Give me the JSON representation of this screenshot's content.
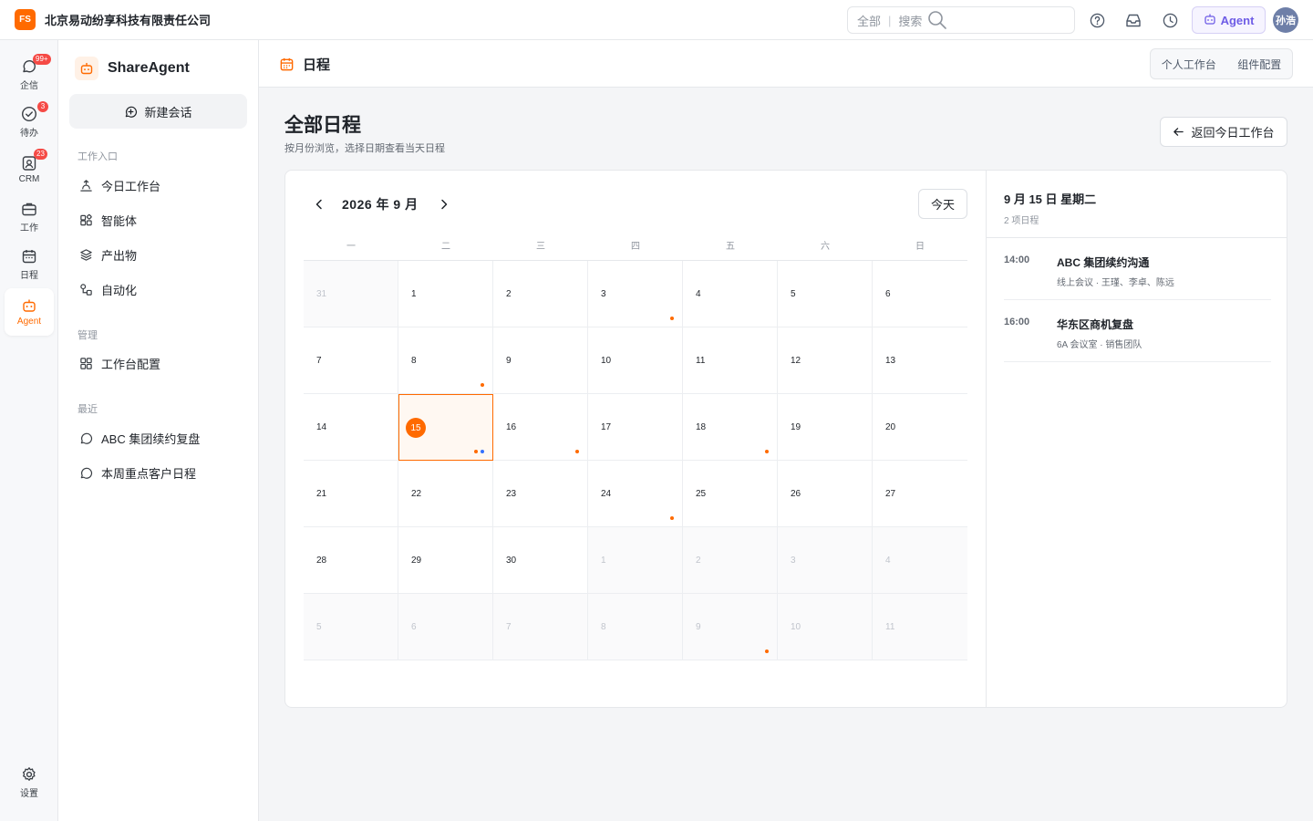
{
  "topbar": {
    "logo_text": "FS",
    "company": "北京易动纷享科技有限责任公司",
    "search_scope": "全部",
    "search_separator": "|",
    "search_placeholder": "搜索",
    "agent_label": "Agent",
    "user_avatar": "孙浩"
  },
  "rail": {
    "items": [
      {
        "label": "企信",
        "icon": "chat-bubble-icon",
        "badge": "99+"
      },
      {
        "label": "待办",
        "icon": "check-circle-icon",
        "badge": "3"
      },
      {
        "label": "CRM",
        "icon": "contacts-icon",
        "badge": "23"
      },
      {
        "label": "工作",
        "icon": "briefcase-icon",
        "badge": ""
      },
      {
        "label": "日程",
        "icon": "calendar-icon",
        "badge": ""
      },
      {
        "label": "Agent",
        "icon": "robot-icon",
        "badge": ""
      }
    ],
    "settings_label": "设置"
  },
  "sidebar": {
    "title": "ShareAgent",
    "new_chat": "新建会话",
    "section_entry": "工作入口",
    "entry_items": [
      "今日工作台",
      "智能体",
      "产出物",
      "自动化"
    ],
    "section_manage": "管理",
    "manage_items": [
      "工作台配置"
    ],
    "section_recent": "最近",
    "recent_items": [
      "ABC 集团续约复盘",
      "本周重点客户日程"
    ]
  },
  "main": {
    "header_title": "日程",
    "tabs": [
      "个人工作台",
      "组件配置"
    ],
    "page_title": "全部日程",
    "page_subtitle": "按月份浏览，选择日期查看当天日程",
    "back_button": "返回今日工作台"
  },
  "calendar": {
    "month_label": "2026 年 9 月",
    "today_button": "今天",
    "weekdays": [
      "一",
      "二",
      "三",
      "四",
      "五",
      "六",
      "日"
    ],
    "days": [
      {
        "d": "31",
        "other": true,
        "dots": []
      },
      {
        "d": "1",
        "other": false,
        "dots": []
      },
      {
        "d": "2",
        "other": false,
        "dots": []
      },
      {
        "d": "3",
        "other": false,
        "dots": [
          "orange"
        ]
      },
      {
        "d": "4",
        "other": false,
        "dots": []
      },
      {
        "d": "5",
        "other": false,
        "dots": []
      },
      {
        "d": "6",
        "other": false,
        "dots": []
      },
      {
        "d": "7",
        "other": false,
        "dots": []
      },
      {
        "d": "8",
        "other": false,
        "dots": [
          "orange"
        ]
      },
      {
        "d": "9",
        "other": false,
        "dots": []
      },
      {
        "d": "10",
        "other": false,
        "dots": []
      },
      {
        "d": "11",
        "other": false,
        "dots": []
      },
      {
        "d": "12",
        "other": false,
        "dots": []
      },
      {
        "d": "13",
        "other": false,
        "dots": []
      },
      {
        "d": "14",
        "other": false,
        "dots": []
      },
      {
        "d": "15",
        "other": false,
        "selected": true,
        "dots": [
          "orange",
          "blue"
        ]
      },
      {
        "d": "16",
        "other": false,
        "dots": [
          "orange"
        ]
      },
      {
        "d": "17",
        "other": false,
        "dots": []
      },
      {
        "d": "18",
        "other": false,
        "dots": [
          "orange"
        ]
      },
      {
        "d": "19",
        "other": false,
        "dots": []
      },
      {
        "d": "20",
        "other": false,
        "dots": []
      },
      {
        "d": "21",
        "other": false,
        "dots": []
      },
      {
        "d": "22",
        "other": false,
        "dots": []
      },
      {
        "d": "23",
        "other": false,
        "dots": []
      },
      {
        "d": "24",
        "other": false,
        "dots": [
          "orange"
        ]
      },
      {
        "d": "25",
        "other": false,
        "dots": []
      },
      {
        "d": "26",
        "other": false,
        "dots": []
      },
      {
        "d": "27",
        "other": false,
        "dots": []
      },
      {
        "d": "28",
        "other": false,
        "dots": []
      },
      {
        "d": "29",
        "other": false,
        "dots": []
      },
      {
        "d": "30",
        "other": false,
        "dots": []
      },
      {
        "d": "1",
        "other": true,
        "dots": []
      },
      {
        "d": "2",
        "other": true,
        "dots": []
      },
      {
        "d": "3",
        "other": true,
        "dots": []
      },
      {
        "d": "4",
        "other": true,
        "dots": []
      },
      {
        "d": "5",
        "other": true,
        "dots": []
      },
      {
        "d": "6",
        "other": true,
        "dots": []
      },
      {
        "d": "7",
        "other": true,
        "dots": []
      },
      {
        "d": "8",
        "other": true,
        "dots": []
      },
      {
        "d": "9",
        "other": true,
        "dots": [
          "orange"
        ]
      },
      {
        "d": "10",
        "other": true,
        "dots": []
      },
      {
        "d": "11",
        "other": true,
        "dots": []
      }
    ]
  },
  "detail": {
    "date": "9 月 15 日 星期二",
    "count": "2 项日程",
    "events": [
      {
        "time": "14:00",
        "title": "ABC 集团续约沟通",
        "meta": "线上会议 · 王瑾、李卓、陈远"
      },
      {
        "time": "16:00",
        "title": "华东区商机复盘",
        "meta": "6A 会议室 · 销售团队"
      }
    ]
  },
  "colors": {
    "accent": "#ff6a00",
    "agent": "#6e5ce6",
    "badge": "#f54a45",
    "event_blue": "#3370ff"
  }
}
